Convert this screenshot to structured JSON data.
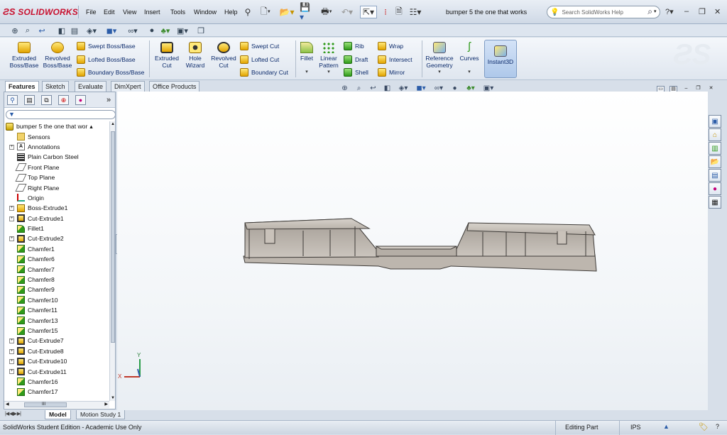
{
  "app": {
    "logo_text": "SOLIDWORKS",
    "document_title": "bumper 5 the one that works"
  },
  "menu": [
    "File",
    "Edit",
    "View",
    "Insert",
    "Tools",
    "Window",
    "Help"
  ],
  "search": {
    "placeholder": "Search SolidWorks Help"
  },
  "command_manager": {
    "large": [
      {
        "label": "Extruded Boss/Base",
        "line1": "Extruded",
        "line2": "Boss/Base"
      },
      {
        "label": "Revolved Boss/Base",
        "line1": "Revolved",
        "line2": "Boss/Base"
      },
      {
        "label": "Extruded Cut",
        "line1": "Extruded",
        "line2": "Cut"
      },
      {
        "label": "Hole Wizard",
        "line1": "Hole",
        "line2": "Wizard"
      },
      {
        "label": "Revolved Cut",
        "line1": "Revolved",
        "line2": "Cut"
      },
      {
        "label": "Fillet",
        "line1": "Fillet",
        "line2": ""
      },
      {
        "label": "Linear Pattern",
        "line1": "Linear",
        "line2": "Pattern"
      },
      {
        "label": "Reference Geometry",
        "line1": "Reference",
        "line2": "Geometry"
      },
      {
        "label": "Curves",
        "line1": "Curves",
        "line2": ""
      },
      {
        "label": "Instant3D",
        "line1": "Instant3D",
        "line2": ""
      }
    ],
    "small": {
      "swept_boss": "Swept Boss/Base",
      "lofted_boss": "Lofted Boss/Base",
      "boundary_boss": "Boundary Boss/Base",
      "swept_cut": "Swept Cut",
      "lofted_cut": "Lofted Cut",
      "boundary_cut": "Boundary Cut",
      "rib": "Rib",
      "draft": "Draft",
      "shell": "Shell",
      "wrap": "Wrap",
      "intersect": "Intersect",
      "mirror": "Mirror"
    }
  },
  "tabs": [
    "Features",
    "Sketch",
    "Evaluate",
    "DimXpert",
    "Office Products"
  ],
  "tree": {
    "root": "bumper 5 the one that wor",
    "items": [
      {
        "label": "Sensors",
        "icon": "sensor-folder-icon",
        "expandable": false
      },
      {
        "label": "Annotations",
        "icon": "annotations-icon",
        "expandable": true
      },
      {
        "label": "Plain Carbon Steel",
        "icon": "material-icon",
        "expandable": false
      },
      {
        "label": "Front Plane",
        "icon": "plane-icon",
        "expandable": false
      },
      {
        "label": "Top Plane",
        "icon": "plane-icon",
        "expandable": false
      },
      {
        "label": "Right Plane",
        "icon": "plane-icon",
        "expandable": false
      },
      {
        "label": "Origin",
        "icon": "origin-icon",
        "expandable": false
      },
      {
        "label": "Boss-Extrude1",
        "icon": "boss-extrude-icon",
        "expandable": true
      },
      {
        "label": "Cut-Extrude1",
        "icon": "cut-extrude-icon",
        "expandable": true
      },
      {
        "label": "Fillet1",
        "icon": "fillet-icon",
        "expandable": false
      },
      {
        "label": "Cut-Extrude2",
        "icon": "cut-extrude-icon",
        "expandable": true
      },
      {
        "label": "Chamfer1",
        "icon": "chamfer-icon",
        "expandable": false
      },
      {
        "label": "Chamfer6",
        "icon": "chamfer-icon",
        "expandable": false
      },
      {
        "label": "Chamfer7",
        "icon": "chamfer-icon",
        "expandable": false
      },
      {
        "label": "Chamfer8",
        "icon": "chamfer-icon",
        "expandable": false
      },
      {
        "label": "Chamfer9",
        "icon": "chamfer-icon",
        "expandable": false
      },
      {
        "label": "Chamfer10",
        "icon": "chamfer-icon",
        "expandable": false
      },
      {
        "label": "Chamfer11",
        "icon": "chamfer-icon",
        "expandable": false
      },
      {
        "label": "Chamfer13",
        "icon": "chamfer-icon",
        "expandable": false
      },
      {
        "label": "Chamfer15",
        "icon": "chamfer-icon",
        "expandable": false
      },
      {
        "label": "Cut-Extrude7",
        "icon": "cut-extrude-icon",
        "expandable": true
      },
      {
        "label": "Cut-Extrude8",
        "icon": "cut-extrude-icon",
        "expandable": true
      },
      {
        "label": "Cut-Extrude10",
        "icon": "cut-extrude-icon",
        "expandable": true
      },
      {
        "label": "Cut-Extrude11",
        "icon": "cut-extrude-icon",
        "expandable": true
      },
      {
        "label": "Chamfer16",
        "icon": "chamfer-icon",
        "expandable": false
      },
      {
        "label": "Chamfer17",
        "icon": "chamfer-icon",
        "expandable": false
      }
    ]
  },
  "scrollbar_thumb_text": "III",
  "bottom_tabs": [
    "Model",
    "Motion Study 1"
  ],
  "triad": {
    "x": "X",
    "y": "Y"
  },
  "status": {
    "left": "SolidWorks Student Edition - Academic Use Only",
    "mode": "Editing Part",
    "units": "IPS"
  },
  "colors": {
    "brand": "#c8102e",
    "model_fill": "#c9c3bb",
    "accent": "#0b2a6b"
  }
}
